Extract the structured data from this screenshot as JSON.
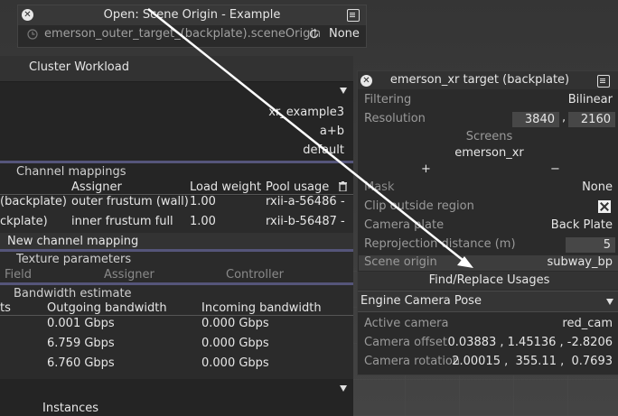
{
  "popup": {
    "title": "Open: Scene Origin - Example",
    "path": "emerson_outer_target_(backplate).sceneOrigin",
    "value": "None"
  },
  "cluster": {
    "title": "Cluster Workload",
    "config_values": [
      "xr_example3",
      "a+b",
      "default"
    ],
    "channel_section": "Channel mappings",
    "channel_headers": [
      "Assigner",
      "Load weight",
      "Pool usage"
    ],
    "channel_rows": [
      {
        "name": "(backplate)",
        "assigner": "outer frustum (wall)",
        "weight": "1.00",
        "pool": "rxii-a-56486",
        "x": "-"
      },
      {
        "name": "ckplate)",
        "assigner": "inner frustum full",
        "weight": "1.00",
        "pool": "rxii-b-56487",
        "x": "-"
      }
    ],
    "new_mapping": "New channel mapping",
    "texture_section": "Texture parameters",
    "texture_headers": [
      "Field",
      "Assigner",
      "Controller"
    ],
    "bandwidth_section": "Bandwidth estimate",
    "bandwidth_headers": [
      "ts",
      "Outgoing bandwidth",
      "Incoming bandwidth"
    ],
    "bandwidth_rows": [
      {
        "out": "0.001 Gbps",
        "in": "0.000 Gbps"
      },
      {
        "out": "6.759 Gbps",
        "in": "0.000 Gbps"
      },
      {
        "out": "6.760 Gbps",
        "in": "0.000 Gbps"
      }
    ],
    "instances": "Instances"
  },
  "target": {
    "title": "emerson_xr target (backplate)",
    "filtering_label": "Filtering",
    "filtering_value": "Bilinear",
    "resolution_label": "Resolution",
    "res_w": "3840",
    "res_h": "2160",
    "screens_label": "Screens",
    "screens_value": "emerson_xr",
    "plus": "+",
    "minus": "−",
    "mask_label": "Mask",
    "mask_value": "None",
    "clip_label": "Clip outside region",
    "camera_plate_label": "Camera plate",
    "camera_plate_value": "Back Plate",
    "reproj_label": "Reprojection distance (m)",
    "reproj_value": "5",
    "scene_origin_label": "Scene origin",
    "scene_origin_value": "subway_bp",
    "find_replace": "Find/Replace Usages",
    "ecp_title": "Engine Camera Pose",
    "active_cam_label": "Active camera",
    "active_cam_value": "red_cam",
    "cam_offset_label": "Camera offset",
    "cam_offset_value": "0.03883 , 1.45136 , -2.8206",
    "cam_rot_label": "Camera rotation",
    "cam_rot_value": "2.00015 ,  355.11 ,  0.7693"
  },
  "comma": ","
}
